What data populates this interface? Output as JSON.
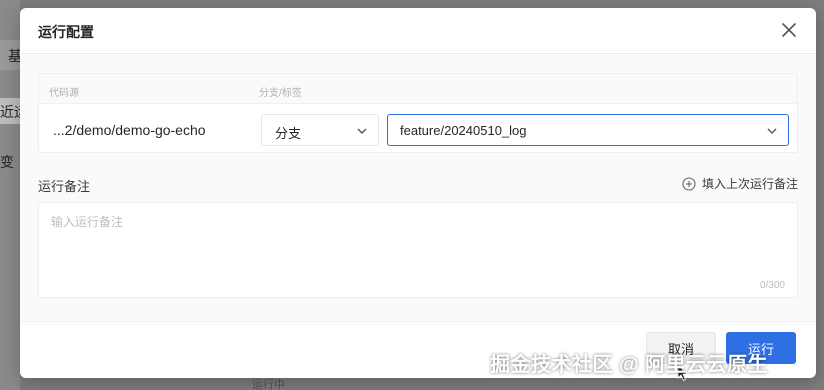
{
  "modal": {
    "title": "运行配置",
    "source_card": {
      "source_label": "代码源",
      "branch_label": "分支/标签",
      "repo_path": "...2/demo/demo-go-echo",
      "ref_type": "分支",
      "branch_value": "feature/20240510_log"
    },
    "notes": {
      "label": "运行备注",
      "fill_last_label": "填入上次运行备注",
      "placeholder": "输入运行备注",
      "char_count": "0/300"
    },
    "footer": {
      "cancel_label": "取消",
      "run_label": "运行"
    }
  },
  "watermark": "掘金技术社区 @ 阿里云云原生",
  "colors": {
    "primary": "#2f6fe4",
    "overlay": "#7d7d7d"
  },
  "icons": [
    "close-icon",
    "chevron-down-icon",
    "plus-circle-icon",
    "cursor-icon"
  ]
}
